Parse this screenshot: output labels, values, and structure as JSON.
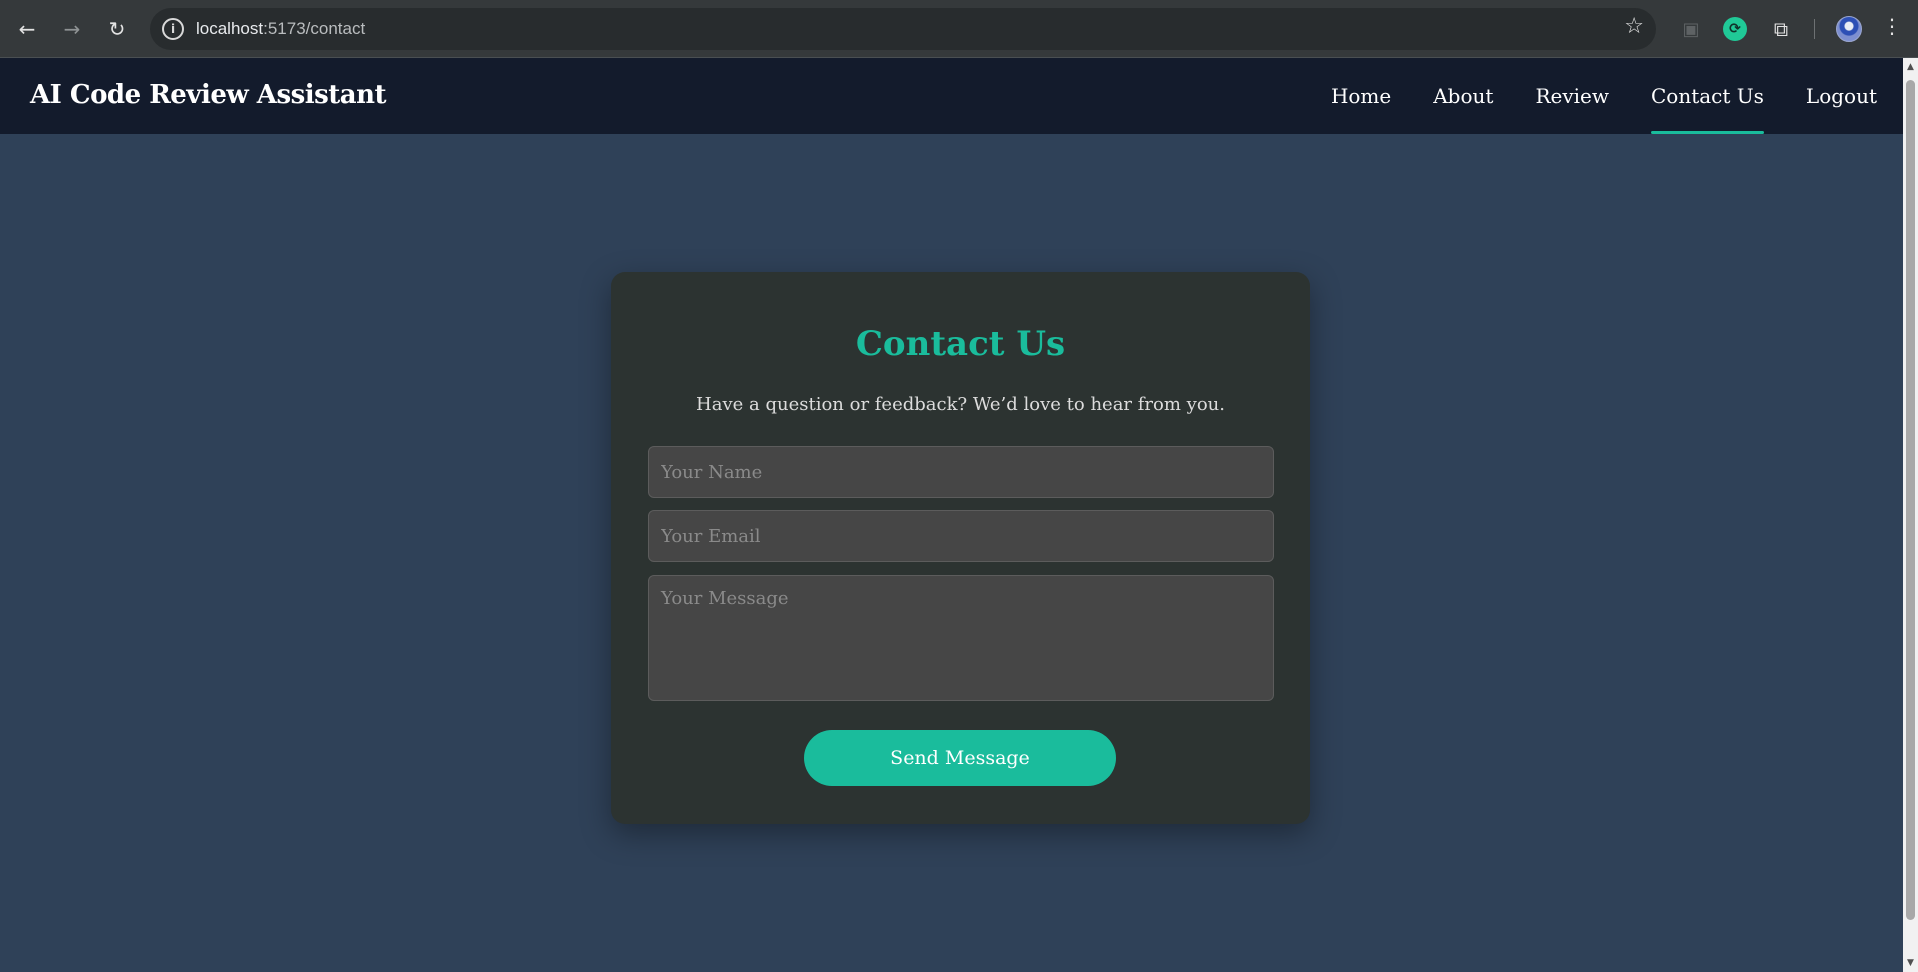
{
  "browser": {
    "url_host": "localhost",
    "url_path": ":5173/contact",
    "icons": {
      "back": "arrow-left-icon",
      "forward": "arrow-right-icon",
      "reload": "reload-icon",
      "site_info": "info-icon",
      "bookmark": "star-icon",
      "extensions": "puzzle-icon",
      "menu": "kebab-menu-icon"
    }
  },
  "navbar": {
    "brand": "AI Code Review Assistant",
    "links": [
      {
        "label": "Home",
        "active": false
      },
      {
        "label": "About",
        "active": false
      },
      {
        "label": "Review",
        "active": false
      },
      {
        "label": "Contact Us",
        "active": true
      },
      {
        "label": "Logout",
        "active": false
      }
    ]
  },
  "contact": {
    "title": "Contact Us",
    "subtitle": "Have a question or feedback? We’d love to hear from you.",
    "name_placeholder": "Your Name",
    "email_placeholder": "Your Email",
    "message_placeholder": "Your Message",
    "submit_label": "Send Message"
  },
  "colors": {
    "accent": "#1abc9c",
    "navbar_bg": "#131b2c",
    "page_bg": "#2f4158",
    "card_bg": "#2c3331",
    "input_bg": "#464646"
  }
}
